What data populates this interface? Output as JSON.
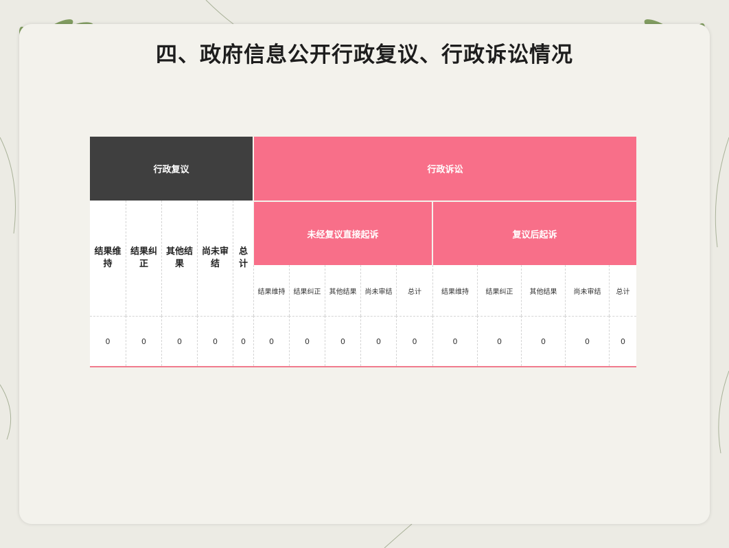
{
  "slide": {
    "title": "四、政府信息公开行政复议、行政诉讼情况"
  },
  "table": {
    "review_group": "行政复议",
    "litigation_group": "行政诉讼",
    "direct_suit": "未经复议直接起诉",
    "after_review_suit": "复议后起诉",
    "review_headers": [
      "结果维持",
      "结果纠正",
      "其他结果",
      "尚未审结",
      "总计"
    ],
    "litigation_headers": [
      "结果维持",
      "结果纠正",
      "其他结果",
      "尚未审结",
      "总计",
      "结果维持",
      "结果纠正",
      "其他结果",
      "尚未审结",
      "总计"
    ],
    "review_values": [
      "0",
      "0",
      "0",
      "0",
      "0"
    ],
    "litigation_values": [
      "0",
      "0",
      "0",
      "0",
      "0",
      "0",
      "0",
      "0",
      "0",
      "0"
    ]
  },
  "colors": {
    "dark_header": "#3f3f3f",
    "pink_header": "#f86f89",
    "accent_line": "#f07a8d"
  }
}
